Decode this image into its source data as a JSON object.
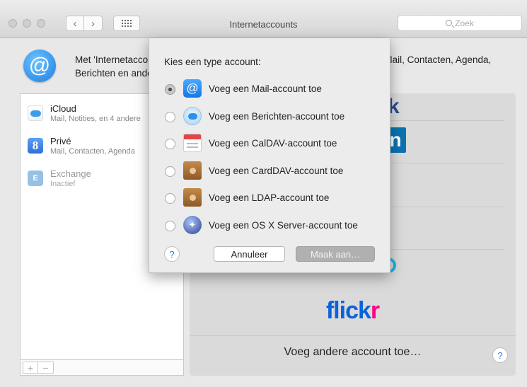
{
  "window": {
    "title": "Internetaccounts",
    "search_placeholder": "Zoek"
  },
  "header": {
    "text": "Met 'Internetaccounts' kunt u uw accounts configureren voor gebruik met Mail, Contacten, Agenda, Berichten en andere apps."
  },
  "accounts": [
    {
      "name": "iCloud",
      "detail": "Mail, Notities, en 4 andere",
      "icon": "icloud-icon"
    },
    {
      "name": "Privé",
      "detail": "Mail, Contacten, Agenda",
      "icon": "google-icon"
    },
    {
      "name": "Exchange",
      "detail": "Inactief",
      "icon": "exchange-icon"
    }
  ],
  "list_controls": {
    "add": "+",
    "remove": "−"
  },
  "providers": {
    "fragment_1": "k",
    "fragment_2": "n",
    "flickr_part1": "flick",
    "flickr_part2": "r",
    "other": "Voeg andere account toe…",
    "help": "?"
  },
  "sheet": {
    "title": "Kies een type account:",
    "options": [
      {
        "label": "Voeg een Mail-account toe",
        "icon": "mail-icon",
        "selected": true
      },
      {
        "label": "Voeg een Berichten-account toe",
        "icon": "messages-icon",
        "selected": false
      },
      {
        "label": "Voeg een CalDAV-account toe",
        "icon": "calendar-icon",
        "selected": false
      },
      {
        "label": "Voeg een CardDAV-account toe",
        "icon": "contacts-icon",
        "selected": false
      },
      {
        "label": "Voeg een LDAP-account toe",
        "icon": "contacts-icon",
        "selected": false
      },
      {
        "label": "Voeg een OS X Server-account toe",
        "icon": "server-icon",
        "selected": false
      }
    ],
    "help": "?",
    "cancel": "Annuleer",
    "create": "Maak aan…"
  }
}
